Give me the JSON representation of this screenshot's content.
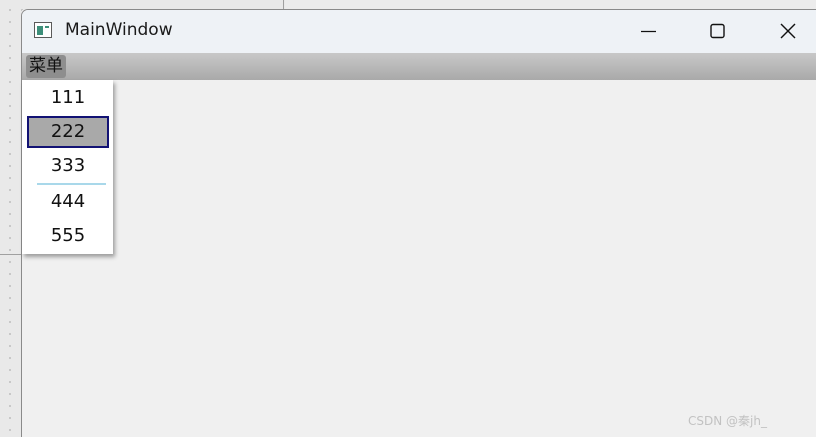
{
  "window": {
    "title": "MainWindow"
  },
  "menubar": {
    "menu_title": "菜单"
  },
  "dropdown": {
    "items": [
      {
        "label": "111"
      },
      {
        "label": "222",
        "state": "highlighted"
      },
      {
        "label": "333"
      },
      {
        "label": "444"
      },
      {
        "label": "555"
      }
    ],
    "separator_after_index": 2
  },
  "watermark": {
    "text": "CSDN @秦jh_"
  },
  "icons": {
    "app": "app-window-icon",
    "minimize": "minimize-icon",
    "maximize": "maximize-icon",
    "close": "close-icon"
  },
  "colors": {
    "highlight_fill": "#a9a9a9",
    "highlight_border": "#121274",
    "separator": "#a9d8ea",
    "menubar": "#b6b6b6"
  }
}
